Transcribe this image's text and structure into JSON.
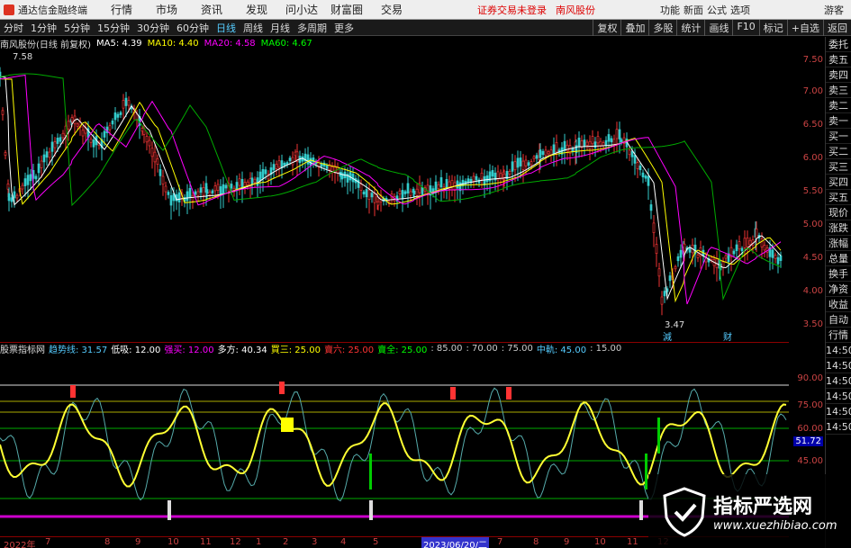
{
  "app": {
    "title": "通达信金融终端",
    "menu": [
      "行情",
      "市场",
      "资讯",
      "发现",
      "问小达",
      "财富圈",
      "交易"
    ],
    "notice": "证券交易未登录",
    "stock": "南风股份",
    "right": [
      "功能",
      "新面",
      "公式",
      "选项"
    ],
    "guest": "游客"
  },
  "toolbar": {
    "items": [
      "分时",
      "1分钟",
      "5分钟",
      "15分钟",
      "30分钟",
      "60分钟",
      "日线",
      "周线",
      "月线",
      "多周期",
      "更多"
    ],
    "active": "日线",
    "right": [
      "复权",
      "叠加",
      "多股",
      "统计",
      "画线",
      "F10",
      "标记",
      "+自选",
      "返回"
    ]
  },
  "legend": {
    "name": "南风股份(日线 前复权)",
    "ma5": "MA5: 4.39",
    "ma10": "MA10: 4.40",
    "ma20": "MA20: 4.58",
    "ma60": "MA60: 4.67",
    "high": "7.58",
    "low": "3.47"
  },
  "yaxis": [
    "7.50",
    "7.00",
    "6.50",
    "6.00",
    "5.50",
    "5.00",
    "4.50",
    "4.00",
    "3.50"
  ],
  "ind": {
    "title": "股票指标网",
    "items": [
      {
        "t": "趋势线: 31.57",
        "c": "#5cf"
      },
      {
        "t": "低吸: 12.00",
        "c": "#fff"
      },
      {
        "t": "强买: 12.00",
        "c": "#f0f"
      },
      {
        "t": "多方: 40.34",
        "c": "#fff"
      },
      {
        "t": "買三: 25.00",
        "c": "#ff0"
      },
      {
        "t": "賣六: 25.00",
        "c": "#f33"
      },
      {
        "t": "賣全: 25.00",
        "c": "#0f0"
      },
      {
        "t": ": 85.00",
        "c": "#ccc"
      },
      {
        "t": ": 70.00",
        "c": "#ccc"
      },
      {
        "t": ": 75.00",
        "c": "#ccc"
      },
      {
        "t": "中軌: 45.00",
        "c": "#5cf"
      },
      {
        "t": ": 15.00",
        "c": "#ccc"
      }
    ]
  },
  "indaxis": [
    "90.00",
    "75.00",
    "60.00",
    "45.00"
  ],
  "indbadge": "51.72",
  "side": [
    "委托",
    "卖五",
    "卖四",
    "卖三",
    "卖二",
    "卖一",
    "买一",
    "买二",
    "买三",
    "买四",
    "买五",
    "现价",
    "涨跌",
    "涨幅",
    "总量",
    "换手",
    "净资",
    "收益",
    "自动",
    "行情"
  ],
  "side2": [
    "14:50",
    "14:50",
    "14:50",
    "14:50",
    "14:50",
    "14:50"
  ],
  "xaxis": [
    "2022年",
    "7",
    "8",
    "9",
    "10",
    "11",
    "12",
    "1",
    "2",
    "3",
    "4",
    "5",
    "2023/06/20/二",
    "7",
    "8",
    "9",
    "10",
    "11",
    "12"
  ],
  "tags": {
    "a": "減",
    "b": "财"
  },
  "watermark": {
    "cn": "指标严选网",
    "url": "www.xuezhibiao.com"
  },
  "chart_data": {
    "type": "line",
    "series": [
      {
        "name": "MA5",
        "values": []
      },
      {
        "name": "MA10",
        "values": []
      },
      {
        "name": "MA20",
        "values": []
      },
      {
        "name": "MA60",
        "values": []
      }
    ],
    "ylim": [
      3.3,
      7.7
    ]
  }
}
